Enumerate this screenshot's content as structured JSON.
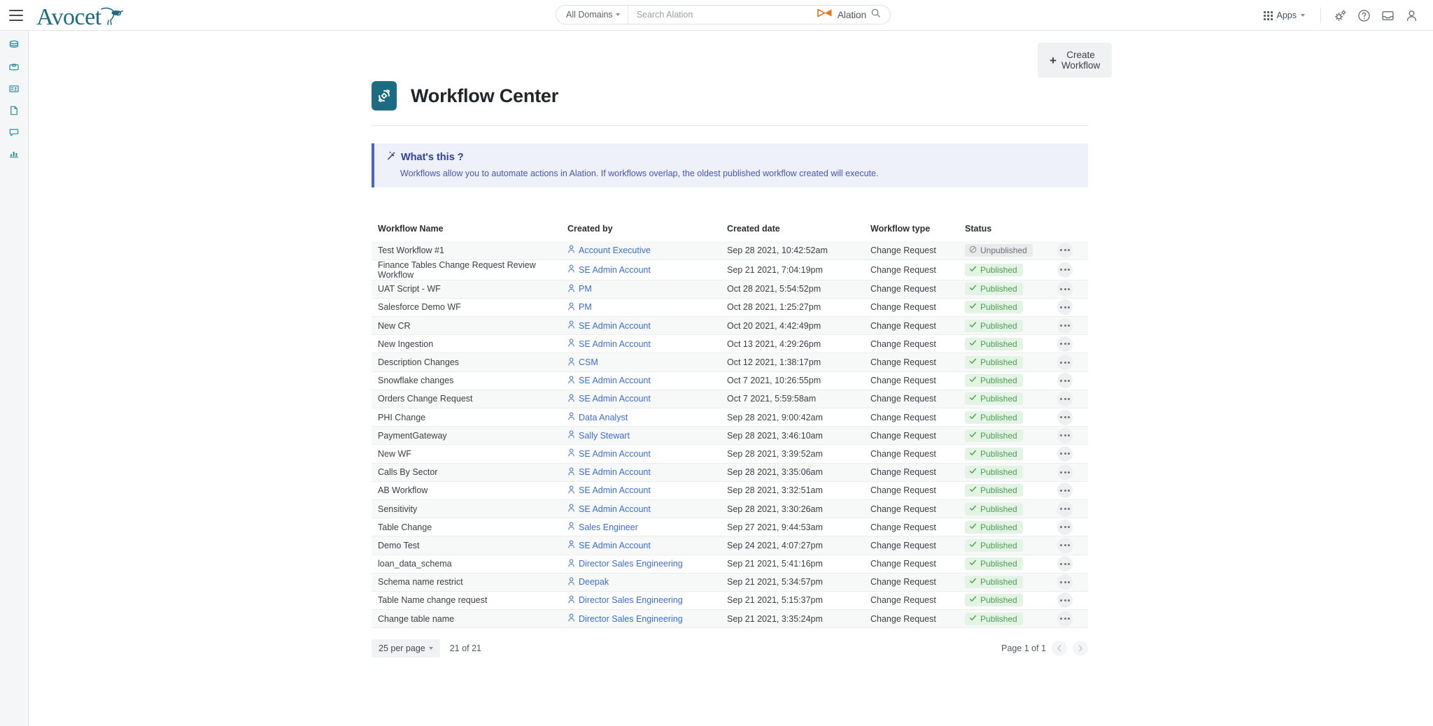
{
  "topbar": {
    "menu_icon": "hamburger-icon",
    "brand": "Avocet",
    "brand_icon": "avocet-bird-icon",
    "brand_color": "#1d6b82",
    "domain_filter": "All Domains",
    "search_placeholder": "Search Alation",
    "search_value": "",
    "alation_label": "Alation",
    "alation_color": "#e8741e",
    "apps_label": "Apps",
    "icons": [
      "apps-grid-icon",
      "settings-gears-icon",
      "help-circle-icon",
      "inbox-icon",
      "user-profile-icon"
    ]
  },
  "sidebar": {
    "items": [
      {
        "icon": "database-icon"
      },
      {
        "icon": "archive-box-icon"
      },
      {
        "icon": "table-grid-icon"
      },
      {
        "icon": "document-icon"
      },
      {
        "icon": "chat-bubble-icon"
      },
      {
        "icon": "bar-chart-icon"
      }
    ]
  },
  "header": {
    "create_button": "Create Workflow",
    "create_icon": "plus-icon",
    "title": "Workflow Center",
    "title_icon": "workflow-refresh-icon"
  },
  "banner": {
    "icon": "magic-wand-icon",
    "title": "What's this ?",
    "body": "Workflows allow you to automate actions in Alation. If workflows overlap, the oldest published workflow created will execute.",
    "accent": "#4a63c8",
    "background": "#eef0fa"
  },
  "table": {
    "columns": [
      "Workflow Name",
      "Created by",
      "Created date",
      "Workflow type",
      "Status",
      ""
    ],
    "rows": [
      {
        "name": "Test Workflow #1",
        "created_by": "Account Executive",
        "created_date": "Sep 28 2021, 10:42:52am",
        "type": "Change Request",
        "status": "Unpublished"
      },
      {
        "name": "Finance Tables Change Request Review Workflow",
        "created_by": "SE Admin Account",
        "created_date": "Sep 21 2021, 7:04:19pm",
        "type": "Change Request",
        "status": "Published"
      },
      {
        "name": "UAT Script - WF",
        "created_by": "PM",
        "created_date": "Oct 28 2021, 5:54:52pm",
        "type": "Change Request",
        "status": "Published"
      },
      {
        "name": "Salesforce Demo WF",
        "created_by": "PM",
        "created_date": "Oct 28 2021, 1:25:27pm",
        "type": "Change Request",
        "status": "Published"
      },
      {
        "name": "New CR",
        "created_by": "SE Admin Account",
        "created_date": "Oct 20 2021, 4:42:49pm",
        "type": "Change Request",
        "status": "Published"
      },
      {
        "name": "New Ingestion",
        "created_by": "SE Admin Account",
        "created_date": "Oct 13 2021, 4:29:26pm",
        "type": "Change Request",
        "status": "Published"
      },
      {
        "name": "Description Changes",
        "created_by": "CSM",
        "created_date": "Oct 12 2021, 1:38:17pm",
        "type": "Change Request",
        "status": "Published"
      },
      {
        "name": "Snowflake changes",
        "created_by": "SE Admin Account",
        "created_date": "Oct 7 2021, 10:26:55pm",
        "type": "Change Request",
        "status": "Published"
      },
      {
        "name": "Orders Change Request",
        "created_by": "SE Admin Account",
        "created_date": "Oct 7 2021, 5:59:58am",
        "type": "Change Request",
        "status": "Published"
      },
      {
        "name": "PHI Change",
        "created_by": "Data Analyst",
        "created_date": "Sep 28 2021, 9:00:42am",
        "type": "Change Request",
        "status": "Published"
      },
      {
        "name": "PaymentGateway",
        "created_by": "Sally Stewart",
        "created_date": "Sep 28 2021, 3:46:10am",
        "type": "Change Request",
        "status": "Published"
      },
      {
        "name": "New WF",
        "created_by": "SE Admin Account",
        "created_date": "Sep 28 2021, 3:39:52am",
        "type": "Change Request",
        "status": "Published"
      },
      {
        "name": "Calls By Sector",
        "created_by": "SE Admin Account",
        "created_date": "Sep 28 2021, 3:35:06am",
        "type": "Change Request",
        "status": "Published"
      },
      {
        "name": "AB Workflow",
        "created_by": "SE Admin Account",
        "created_date": "Sep 28 2021, 3:32:51am",
        "type": "Change Request",
        "status": "Published"
      },
      {
        "name": "Sensitivity",
        "created_by": "SE Admin Account",
        "created_date": "Sep 28 2021, 3:30:26am",
        "type": "Change Request",
        "status": "Published"
      },
      {
        "name": "Table Change",
        "created_by": "Sales Engineer",
        "created_date": "Sep 27 2021, 9:44:53am",
        "type": "Change Request",
        "status": "Published"
      },
      {
        "name": "Demo Test",
        "created_by": "SE Admin Account",
        "created_date": "Sep 24 2021, 4:07:27pm",
        "type": "Change Request",
        "status": "Published"
      },
      {
        "name": "loan_data_schema",
        "created_by": "Director Sales Engineering",
        "created_date": "Sep 21 2021, 5:41:16pm",
        "type": "Change Request",
        "status": "Published"
      },
      {
        "name": "Schema name restrict",
        "created_by": "Deepak",
        "created_date": "Sep 21 2021, 5:34:57pm",
        "type": "Change Request",
        "status": "Published"
      },
      {
        "name": "Table Name change request",
        "created_by": "Director Sales Engineering",
        "created_date": "Sep 21 2021, 5:15:37pm",
        "type": "Change Request",
        "status": "Published"
      },
      {
        "name": "Change table name",
        "created_by": "Director Sales Engineering",
        "created_date": "Sep 21 2021, 3:35:24pm",
        "type": "Change Request",
        "status": "Published"
      }
    ],
    "row_action_icon": "kebab-menu-icon",
    "user_icon": "person-icon",
    "status_icons": {
      "Published": "check-icon",
      "Unpublished": "blocked-circle-icon"
    },
    "status_colors": {
      "Published": "#4e9b55",
      "Unpublished": "#6b7075"
    }
  },
  "footer": {
    "per_page": "25 per page",
    "count": "21 of 21",
    "page_label": "Page 1 of 1",
    "prev_icon": "chevron-left-icon",
    "next_icon": "chevron-right-icon"
  }
}
